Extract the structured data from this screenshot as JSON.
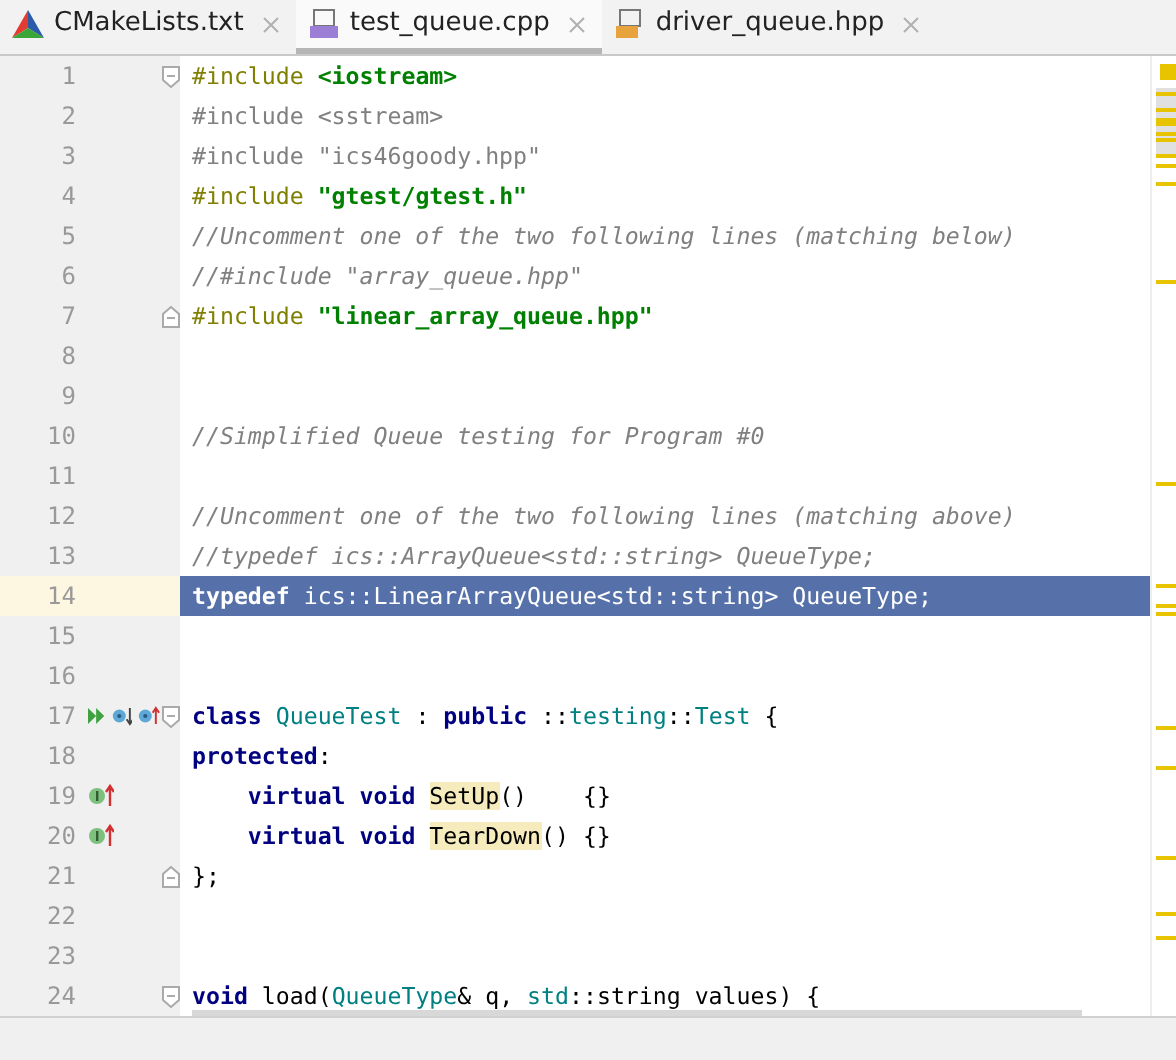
{
  "tabs": [
    {
      "label": "CMakeLists.txt",
      "kind": "cmake",
      "selected": false
    },
    {
      "label": "test_queue.cpp",
      "kind": "cpp",
      "selected": true
    },
    {
      "label": "driver_queue.hpp",
      "kind": "hpp",
      "selected": false
    }
  ],
  "lines": [
    {
      "number": "1",
      "fold_start": true,
      "tokens": [
        {
          "text": "#include ",
          "kind": "directive"
        },
        {
          "text": "<iostream>",
          "kind": "header"
        }
      ]
    },
    {
      "number": "2",
      "tokens": [
        {
          "text": "#include <sstream>",
          "kind": "unused"
        }
      ]
    },
    {
      "number": "3",
      "tokens": [
        {
          "text": "#include \"ics46goody.hpp\"",
          "kind": "unused"
        }
      ]
    },
    {
      "number": "4",
      "tokens": [
        {
          "text": "#include ",
          "kind": "directive"
        },
        {
          "text": "\"gtest/gtest.h\"",
          "kind": "header"
        }
      ]
    },
    {
      "number": "5",
      "tokens": [
        {
          "text": "//Uncomment one of the two following lines (matching below)",
          "kind": "comment"
        }
      ]
    },
    {
      "number": "6",
      "tokens": [
        {
          "text": "//#include \"array_queue.hpp\"",
          "kind": "comment"
        }
      ]
    },
    {
      "number": "7",
      "fold_end": true,
      "tokens": [
        {
          "text": "#include ",
          "kind": "directive"
        },
        {
          "text": "\"linear_array_queue.hpp\"",
          "kind": "header"
        }
      ]
    },
    {
      "number": "8"
    },
    {
      "number": "9"
    },
    {
      "number": "10",
      "tokens": [
        {
          "text": "//Simplified Queue testing for Program #0",
          "kind": "comment"
        }
      ]
    },
    {
      "number": "11"
    },
    {
      "number": "12",
      "tokens": [
        {
          "text": "//Uncomment one of the two following lines (matching above)",
          "kind": "comment"
        }
      ]
    },
    {
      "number": "13",
      "tokens": [
        {
          "text": "//typedef ics::ArrayQueue<std::string> QueueType;",
          "kind": "comment"
        }
      ]
    },
    {
      "number": "14",
      "selected": true,
      "tokens": [
        {
          "text": "typedef",
          "kind": "keyword"
        },
        {
          "text": " ics::LinearArrayQueue<std::string> QueueType;",
          "kind": "plain"
        }
      ]
    },
    {
      "number": "15"
    },
    {
      "number": "16"
    },
    {
      "number": "17",
      "fold_start": true,
      "markers": [
        {
          "kind": "run"
        },
        {
          "kind": "overridden"
        },
        {
          "kind": "overriding"
        }
      ],
      "tokens": [
        {
          "text": "class",
          "kind": "keyword"
        },
        {
          "text": " QueueTest",
          "kind": "type"
        },
        {
          "text": " : ",
          "kind": "plain"
        },
        {
          "text": "public",
          "kind": "keyword"
        },
        {
          "text": " ::",
          "kind": "plain"
        },
        {
          "text": "testing",
          "kind": "type"
        },
        {
          "text": "::",
          "kind": "plain"
        },
        {
          "text": "Test",
          "kind": "type"
        },
        {
          "text": " {",
          "kind": "plain"
        }
      ]
    },
    {
      "number": "18",
      "tokens": [
        {
          "text": "protected",
          "kind": "keyword"
        },
        {
          "text": ":",
          "kind": "plain"
        }
      ]
    },
    {
      "number": "19",
      "markers": [
        {
          "kind": "implementing"
        }
      ],
      "tokens": [
        {
          "text": "    virtual void ",
          "kind": "keyword"
        },
        {
          "text": "SetUp",
          "kind": "usage"
        },
        {
          "text": "()    {}",
          "kind": "plain"
        }
      ]
    },
    {
      "number": "20",
      "markers": [
        {
          "kind": "implementing"
        }
      ],
      "tokens": [
        {
          "text": "    virtual void ",
          "kind": "keyword"
        },
        {
          "text": "TearDown",
          "kind": "usage"
        },
        {
          "text": "() {}",
          "kind": "plain"
        }
      ]
    },
    {
      "number": "21",
      "fold_end": true,
      "tokens": [
        {
          "text": "};",
          "kind": "plain"
        }
      ]
    },
    {
      "number": "22"
    },
    {
      "number": "23"
    },
    {
      "number": "24",
      "fold_start": true,
      "tokens": [
        {
          "text": "void",
          "kind": "keyword"
        },
        {
          "text": " load(",
          "kind": "plain"
        },
        {
          "text": "QueueType",
          "kind": "type"
        },
        {
          "text": "& q, ",
          "kind": "plain"
        },
        {
          "text": "std",
          "kind": "type"
        },
        {
          "text": "::string values) {",
          "kind": "plain"
        }
      ]
    }
  ]
}
